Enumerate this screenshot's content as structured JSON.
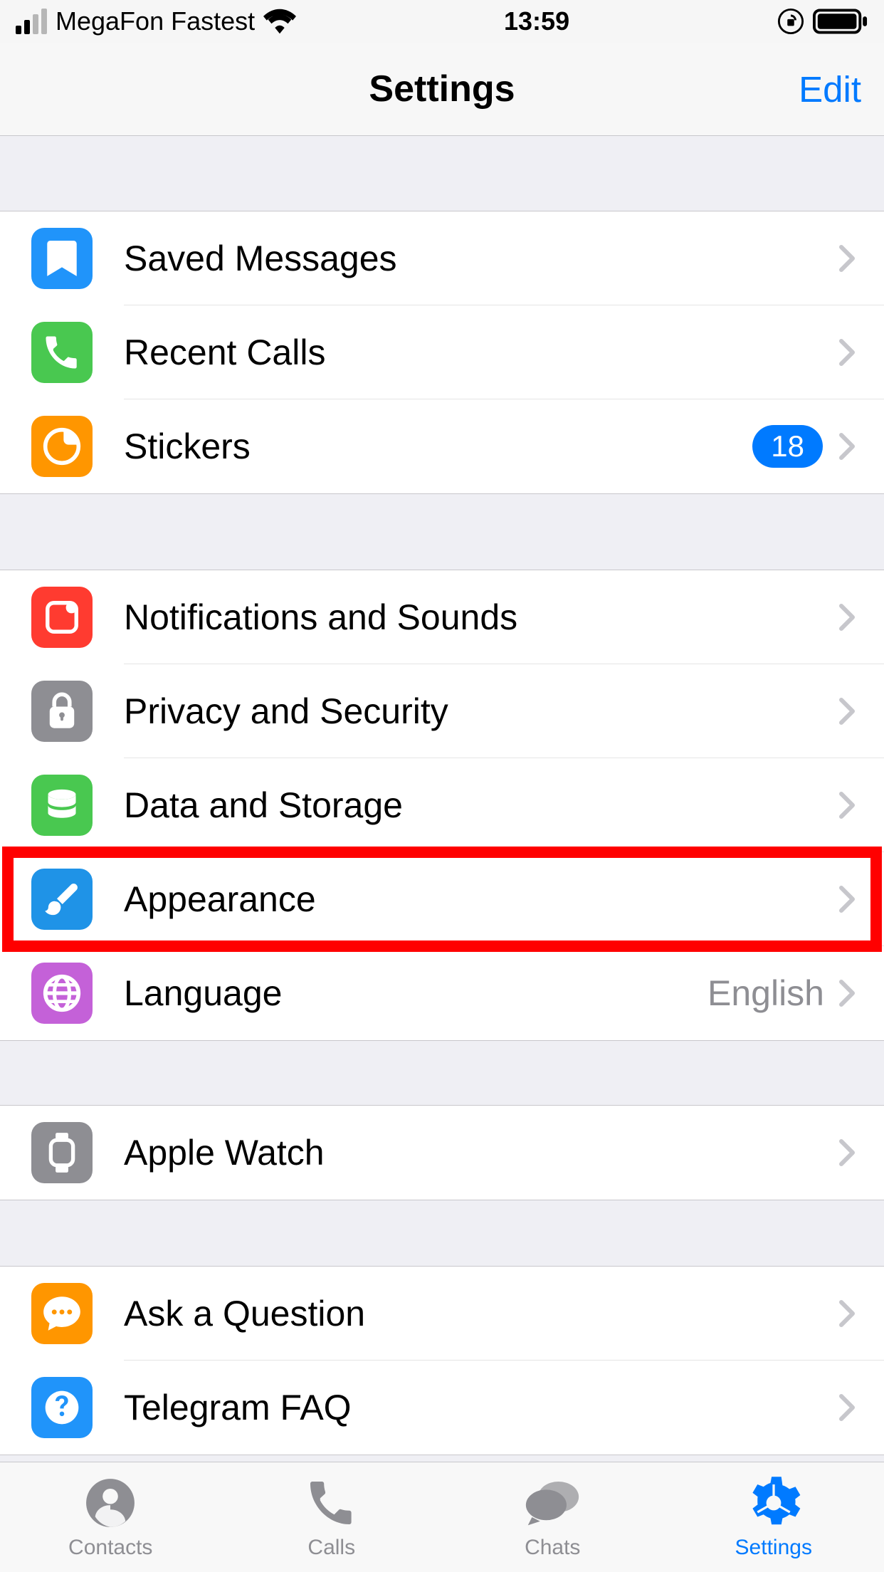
{
  "status": {
    "carrier": "MegaFon Fastest",
    "time": "13:59"
  },
  "nav": {
    "title": "Settings",
    "edit": "Edit"
  },
  "groups": [
    {
      "rows": [
        {
          "key": "saved-messages",
          "label": "Saved Messages",
          "icon": "bookmark",
          "color": "#2094fa"
        },
        {
          "key": "recent-calls",
          "label": "Recent Calls",
          "icon": "phone",
          "color": "#49c850"
        },
        {
          "key": "stickers",
          "label": "Stickers",
          "icon": "sticker",
          "color": "#ff9600",
          "badge": "18"
        }
      ]
    },
    {
      "rows": [
        {
          "key": "notifications",
          "label": "Notifications and Sounds",
          "icon": "notification",
          "color": "#ff3b30"
        },
        {
          "key": "privacy",
          "label": "Privacy and Security",
          "icon": "lock",
          "color": "#8e8e93"
        },
        {
          "key": "data-storage",
          "label": "Data and Storage",
          "icon": "database",
          "color": "#49c850"
        },
        {
          "key": "appearance",
          "label": "Appearance",
          "icon": "brush",
          "color": "#1f93e7",
          "highlight": true
        },
        {
          "key": "language",
          "label": "Language",
          "icon": "globe",
          "color": "#c461d8",
          "detail": "English"
        }
      ]
    },
    {
      "rows": [
        {
          "key": "apple-watch",
          "label": "Apple Watch",
          "icon": "watch",
          "color": "#8e8e93"
        }
      ]
    },
    {
      "rows": [
        {
          "key": "ask-question",
          "label": "Ask a Question",
          "icon": "chat",
          "color": "#ff9600"
        },
        {
          "key": "telegram-faq",
          "label": "Telegram FAQ",
          "icon": "help",
          "color": "#2094fa"
        }
      ]
    }
  ],
  "tabs": [
    {
      "key": "contacts",
      "label": "Contacts",
      "icon": "contacts"
    },
    {
      "key": "calls",
      "label": "Calls",
      "icon": "phone"
    },
    {
      "key": "chats",
      "label": "Chats",
      "icon": "chats"
    },
    {
      "key": "settings",
      "label": "Settings",
      "icon": "gear",
      "active": true
    }
  ]
}
